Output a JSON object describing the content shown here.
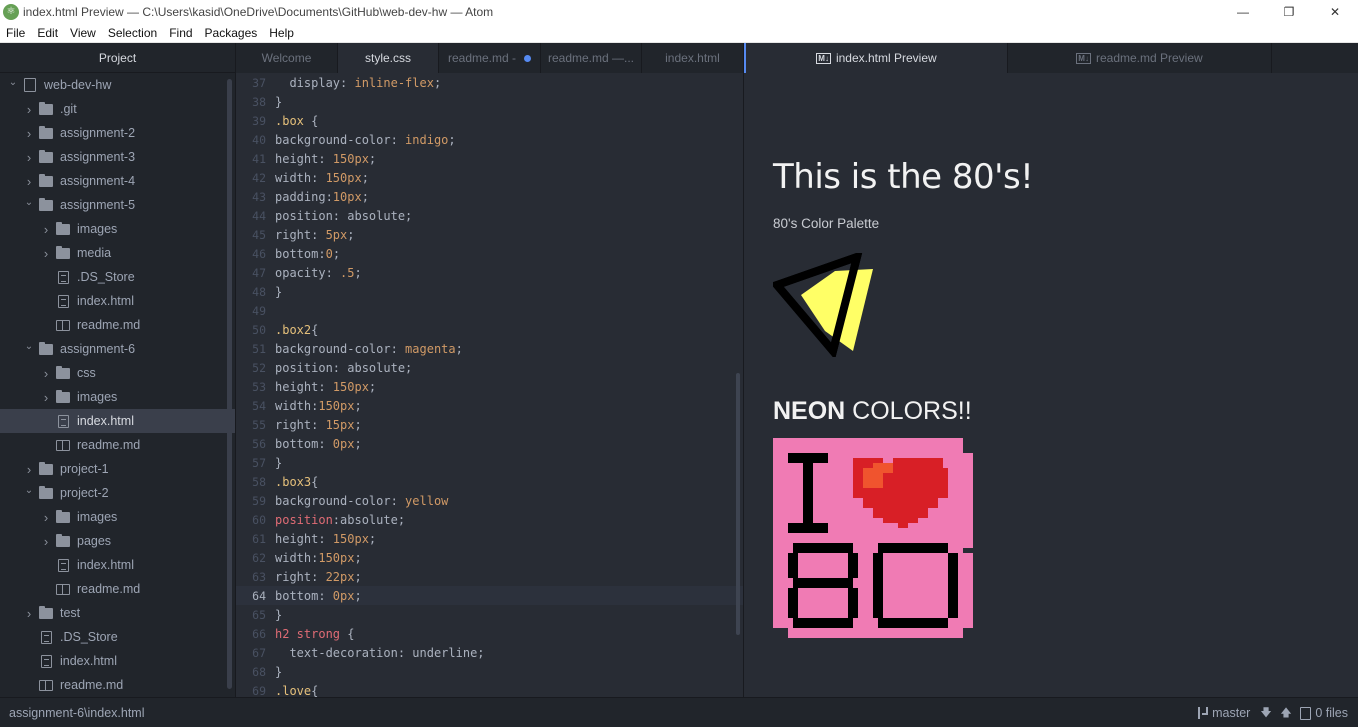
{
  "window": {
    "title": "index.html Preview — C:\\Users\\kasid\\OneDrive\\Documents\\GitHub\\web-dev-hw — Atom",
    "minimize": "—",
    "maximize": "❐",
    "close": "✕",
    "app_icon": "atom-icon"
  },
  "menu": [
    "File",
    "Edit",
    "View",
    "Selection",
    "Find",
    "Packages",
    "Help"
  ],
  "tree": {
    "header": "Project",
    "selected_index": 14,
    "rows": [
      {
        "label": "web-dev-hw",
        "type": "repo",
        "depth": 0,
        "expanded": true
      },
      {
        "label": ".git",
        "type": "folder",
        "depth": 1,
        "expanded": false
      },
      {
        "label": "assignment-2",
        "type": "folder",
        "depth": 1,
        "expanded": false
      },
      {
        "label": "assignment-3",
        "type": "folder",
        "depth": 1,
        "expanded": false
      },
      {
        "label": "assignment-4",
        "type": "folder",
        "depth": 1,
        "expanded": false
      },
      {
        "label": "assignment-5",
        "type": "folder",
        "depth": 1,
        "expanded": true
      },
      {
        "label": "images",
        "type": "folder",
        "depth": 2,
        "expanded": false
      },
      {
        "label": "media",
        "type": "folder",
        "depth": 2,
        "expanded": false
      },
      {
        "label": ".DS_Store",
        "type": "file",
        "depth": 2
      },
      {
        "label": "index.html",
        "type": "file",
        "depth": 2
      },
      {
        "label": "readme.md",
        "type": "md",
        "depth": 2
      },
      {
        "label": "assignment-6",
        "type": "folder",
        "depth": 1,
        "expanded": true
      },
      {
        "label": "css",
        "type": "folder",
        "depth": 2,
        "expanded": false
      },
      {
        "label": "images",
        "type": "folder",
        "depth": 2,
        "expanded": false
      },
      {
        "label": "index.html",
        "type": "file",
        "depth": 2
      },
      {
        "label": "readme.md",
        "type": "md",
        "depth": 2
      },
      {
        "label": "project-1",
        "type": "folder",
        "depth": 1,
        "expanded": false
      },
      {
        "label": "project-2",
        "type": "folder",
        "depth": 1,
        "expanded": true
      },
      {
        "label": "images",
        "type": "folder",
        "depth": 2,
        "expanded": false
      },
      {
        "label": "pages",
        "type": "folder",
        "depth": 2,
        "expanded": false
      },
      {
        "label": "index.html",
        "type": "file",
        "depth": 2
      },
      {
        "label": "readme.md",
        "type": "md",
        "depth": 2
      },
      {
        "label": "test",
        "type": "folder",
        "depth": 1,
        "expanded": false
      },
      {
        "label": ".DS_Store",
        "type": "file",
        "depth": 1
      },
      {
        "label": "index.html",
        "type": "file",
        "depth": 1
      },
      {
        "label": "readme.md",
        "type": "md",
        "depth": 1
      }
    ]
  },
  "tabs": [
    {
      "label": "Welcome",
      "active": false,
      "modified": false
    },
    {
      "label": "style.css",
      "active": true,
      "modified": false
    },
    {
      "label": "readme.md -",
      "active": false,
      "modified": true
    },
    {
      "label": "readme.md —...",
      "active": false,
      "modified": false
    },
    {
      "label": "index.html",
      "active": false,
      "modified": false
    },
    {
      "label": "index.html Preview",
      "active": true,
      "modified": false,
      "badge": "M↓"
    },
    {
      "label": "readme.md Preview",
      "active": false,
      "modified": false,
      "badge": "M↓"
    }
  ],
  "editor": {
    "cursor_line": 64,
    "lines": [
      {
        "n": "37",
        "tokens": [
          [
            "plain",
            "  display: "
          ],
          [
            "val",
            "inline-flex"
          ],
          [
            "plain",
            ";"
          ]
        ]
      },
      {
        "n": "38",
        "tokens": [
          [
            "plain",
            "}"
          ]
        ]
      },
      {
        "n": "39",
        "tokens": [
          [
            "sel",
            ".box"
          ],
          [
            "plain",
            " {"
          ]
        ]
      },
      {
        "n": "40",
        "tokens": [
          [
            "plain",
            "background-color: "
          ],
          [
            "val",
            "indigo"
          ],
          [
            "plain",
            ";"
          ]
        ]
      },
      {
        "n": "41",
        "tokens": [
          [
            "plain",
            "height: "
          ],
          [
            "val",
            "150px"
          ],
          [
            "plain",
            ";"
          ]
        ]
      },
      {
        "n": "42",
        "tokens": [
          [
            "plain",
            "width: "
          ],
          [
            "val",
            "150px"
          ],
          [
            "plain",
            ";"
          ]
        ]
      },
      {
        "n": "43",
        "tokens": [
          [
            "plain",
            "padding:"
          ],
          [
            "val",
            "10px"
          ],
          [
            "plain",
            ";"
          ]
        ]
      },
      {
        "n": "44",
        "tokens": [
          [
            "plain",
            "position: absolute;"
          ]
        ]
      },
      {
        "n": "45",
        "tokens": [
          [
            "plain",
            "right: "
          ],
          [
            "val",
            "5px"
          ],
          [
            "plain",
            ";"
          ]
        ]
      },
      {
        "n": "46",
        "tokens": [
          [
            "plain",
            "bottom:"
          ],
          [
            "val",
            "0"
          ],
          [
            "plain",
            ";"
          ]
        ]
      },
      {
        "n": "47",
        "tokens": [
          [
            "plain",
            "opacity: "
          ],
          [
            "val",
            ".5"
          ],
          [
            "plain",
            ";"
          ]
        ]
      },
      {
        "n": "48",
        "tokens": [
          [
            "plain",
            "}"
          ]
        ]
      },
      {
        "n": "49",
        "tokens": []
      },
      {
        "n": "50",
        "tokens": [
          [
            "sel",
            ".box2"
          ],
          [
            "plain",
            "{"
          ]
        ]
      },
      {
        "n": "51",
        "tokens": [
          [
            "plain",
            "background-color: "
          ],
          [
            "val",
            "magenta"
          ],
          [
            "plain",
            ";"
          ]
        ]
      },
      {
        "n": "52",
        "tokens": [
          [
            "plain",
            "position: absolute;"
          ]
        ]
      },
      {
        "n": "53",
        "tokens": [
          [
            "plain",
            "height: "
          ],
          [
            "val",
            "150px"
          ],
          [
            "plain",
            ";"
          ]
        ]
      },
      {
        "n": "54",
        "tokens": [
          [
            "plain",
            "width:"
          ],
          [
            "val",
            "150px"
          ],
          [
            "plain",
            ";"
          ]
        ]
      },
      {
        "n": "55",
        "tokens": [
          [
            "plain",
            "right: "
          ],
          [
            "val",
            "15px"
          ],
          [
            "plain",
            ";"
          ]
        ]
      },
      {
        "n": "56",
        "tokens": [
          [
            "plain",
            "bottom: "
          ],
          [
            "val",
            "0px"
          ],
          [
            "plain",
            ";"
          ]
        ]
      },
      {
        "n": "57",
        "tokens": [
          [
            "plain",
            "}"
          ]
        ]
      },
      {
        "n": "58",
        "tokens": [
          [
            "sel",
            ".box3"
          ],
          [
            "plain",
            "{"
          ]
        ]
      },
      {
        "n": "59",
        "tokens": [
          [
            "plain",
            "background-color: "
          ],
          [
            "val",
            "yellow"
          ]
        ]
      },
      {
        "n": "60",
        "tokens": [
          [
            "tag",
            "position"
          ],
          [
            "plain",
            ":absolute;"
          ]
        ]
      },
      {
        "n": "61",
        "tokens": [
          [
            "plain",
            "height: "
          ],
          [
            "val",
            "150px"
          ],
          [
            "plain",
            ";"
          ]
        ]
      },
      {
        "n": "62",
        "tokens": [
          [
            "plain",
            "width:"
          ],
          [
            "val",
            "150px"
          ],
          [
            "plain",
            ";"
          ]
        ]
      },
      {
        "n": "63",
        "tokens": [
          [
            "plain",
            "right: "
          ],
          [
            "val",
            "22px"
          ],
          [
            "plain",
            ";"
          ]
        ]
      },
      {
        "n": "64",
        "tokens": [
          [
            "plain",
            "bottom: "
          ],
          [
            "val",
            "0px"
          ],
          [
            "plain",
            ";"
          ]
        ]
      },
      {
        "n": "65",
        "tokens": [
          [
            "plain",
            "}"
          ]
        ]
      },
      {
        "n": "66",
        "tokens": [
          [
            "tag",
            "h2 strong"
          ],
          [
            "plain",
            " {"
          ]
        ]
      },
      {
        "n": "67",
        "tokens": [
          [
            "plain",
            "  text-decoration: underline;"
          ]
        ]
      },
      {
        "n": "68",
        "tokens": [
          [
            "plain",
            "}"
          ]
        ]
      },
      {
        "n": "69",
        "tokens": [
          [
            "sel",
            ".love"
          ],
          [
            "plain",
            "{"
          ]
        ]
      }
    ]
  },
  "preview": {
    "heading": "This is the 80's!",
    "subheading": "80's Color Palette",
    "h2_strong": "NEON",
    "h2_rest": " COLORS!!",
    "logo_icon": "neon-triangle-logo",
    "badge_icon": "i-love-80s-pixel-badge",
    "colors": {
      "yellow": "#ffff66",
      "pink": "#f07bb4",
      "heart": "#d81f26",
      "heart_light": "#f0542e",
      "black": "#000000"
    }
  },
  "status": {
    "path": "assignment-6\\index.html",
    "branch": "master",
    "fetch": "🡇",
    "push": "🡅",
    "files": "0 files"
  }
}
